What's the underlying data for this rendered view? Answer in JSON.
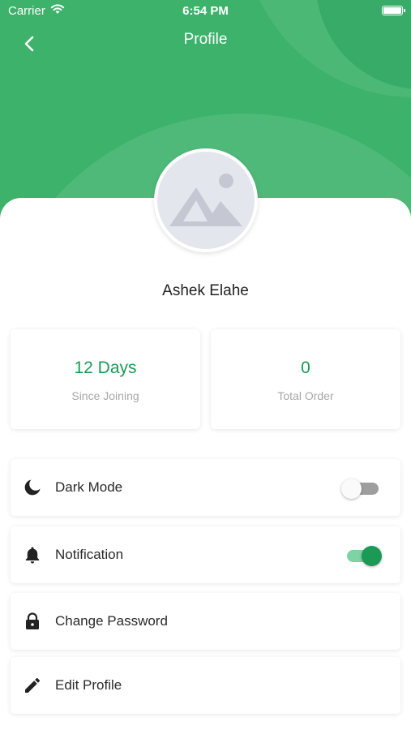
{
  "status_bar": {
    "carrier": "Carrier",
    "time": "6:54 PM"
  },
  "header": {
    "title": "Profile",
    "back_icon": "chevron-left-icon"
  },
  "profile": {
    "name": "Ashek Elahe",
    "avatar_icon": "image-placeholder-icon"
  },
  "stats": [
    {
      "value": "12 Days",
      "label": "Since Joining"
    },
    {
      "value": "0",
      "label": "Total Order"
    }
  ],
  "menu": [
    {
      "label": "Dark Mode",
      "icon": "moon-icon",
      "toggle": false
    },
    {
      "label": "Notification",
      "icon": "bell-icon",
      "toggle": true
    },
    {
      "label": "Change Password",
      "icon": "lock-icon"
    },
    {
      "label": "Edit Profile",
      "icon": "pencil-icon"
    }
  ],
  "colors": {
    "primary": "#3cb26a",
    "accent_text": "#1a9a54",
    "muted_text": "#a7a7a7",
    "toggle_on_track": "#7dd3a3",
    "toggle_off_track": "#9e9e9e"
  }
}
